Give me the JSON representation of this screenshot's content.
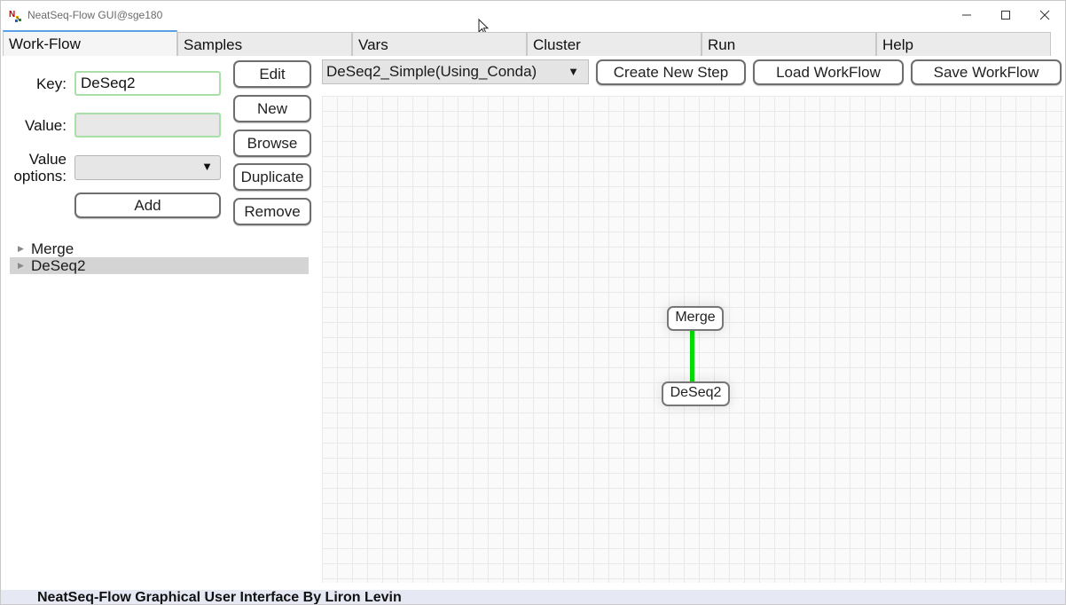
{
  "window": {
    "title": "NeatSeq-Flow GUI@sge180",
    "controls": {
      "minimize": "—",
      "maximize": "☐",
      "close": "✕"
    }
  },
  "tabs": [
    {
      "label": "Work-Flow",
      "active": true
    },
    {
      "label": "Samples",
      "active": false
    },
    {
      "label": "Vars",
      "active": false
    },
    {
      "label": "Cluster",
      "active": false
    },
    {
      "label": "Run",
      "active": false
    },
    {
      "label": "Help",
      "active": false
    }
  ],
  "editor": {
    "key_label": "Key:",
    "key_value": "DeSeq2",
    "value_label": "Value:",
    "value_value": "",
    "value_options_label_line1": "Value",
    "value_options_label_line2": "options:",
    "value_options_selected": "",
    "add_label": "Add",
    "buttons": {
      "edit": "Edit",
      "new": "New",
      "browse": "Browse",
      "duplicate": "Duplicate",
      "remove": "Remove"
    }
  },
  "tree": [
    {
      "label": "Merge",
      "selected": false
    },
    {
      "label": "DeSeq2",
      "selected": true
    }
  ],
  "toolbar": {
    "step_template": "DeSeq2_Simple(Using_Conda)",
    "create_new_step": "Create New Step",
    "load_workflow": "Load WorkFlow",
    "save_workflow": "Save WorkFlow"
  },
  "graph": {
    "nodes": [
      "Merge",
      "DeSeq2"
    ],
    "edges": [
      {
        "from": "Merge",
        "to": "DeSeq2"
      }
    ],
    "edge_color": "#00dd00"
  },
  "status": {
    "text": "NeatSeq-Flow Graphical User Interface By Liron Levin"
  },
  "colors": {
    "active_tab_accent": "#5aa0e6",
    "field_border": "#a8e0a8"
  }
}
